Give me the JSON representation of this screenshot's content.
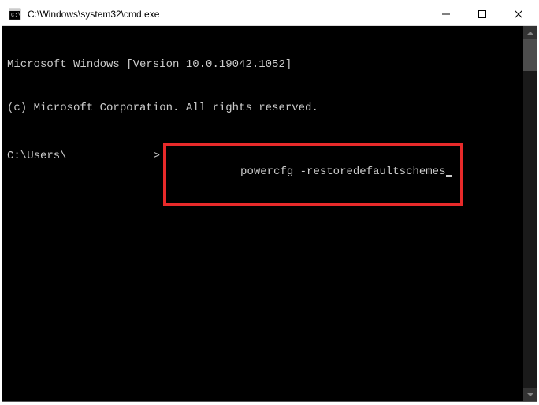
{
  "titlebar": {
    "title": "C:\\Windows\\system32\\cmd.exe"
  },
  "console": {
    "line1": "Microsoft Windows [Version 10.0.19042.1052]",
    "line2": "(c) Microsoft Corporation. All rights reserved.",
    "prompt_prefix": "C:\\Users\\",
    "prompt_suffix": ">",
    "command": "powercfg -restoredefaultschemes"
  }
}
